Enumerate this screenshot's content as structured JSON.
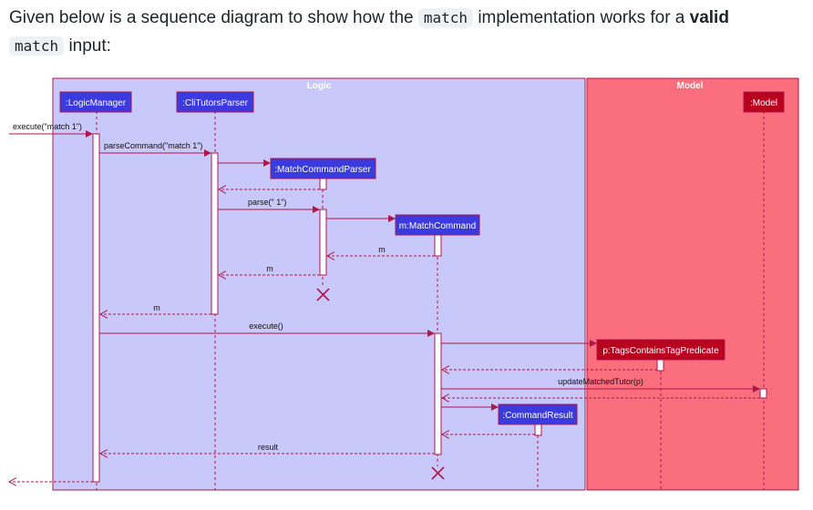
{
  "intro": {
    "part1": "Given below is a sequence diagram to show how the ",
    "code1": "match",
    "part2": " implementation works for a ",
    "bold": "valid",
    "code2": "match",
    "part3": " input:"
  },
  "diagram": {
    "sections": {
      "logic": "Logic",
      "model": "Model"
    },
    "participants": {
      "logic_manager": ":LogicManager",
      "parser": ":CliTutorsParser",
      "match_parser": ":MatchCommandParser",
      "match_command": "m:MatchCommand",
      "predicate": "p:TagsContainsTagPredicate",
      "command_result": ":CommandResult",
      "model": ":Model"
    },
    "messages": {
      "execute_input": "execute(\"match 1\")",
      "parse_command": "parseCommand(\"match 1\")",
      "parse": "parse(\" 1\")",
      "return_m1": "m",
      "return_m2": "m",
      "return_m3": "m",
      "execute": "execute()",
      "update_matched": "updateMatchedTutor(p)",
      "result": "result"
    },
    "colors": {
      "logic_bg": "#c8c8fa",
      "model_bg": "#fa6e7d",
      "logic_box": "#3a3ade",
      "model_box": "#b8001f",
      "arrow": "#b0174a"
    }
  }
}
